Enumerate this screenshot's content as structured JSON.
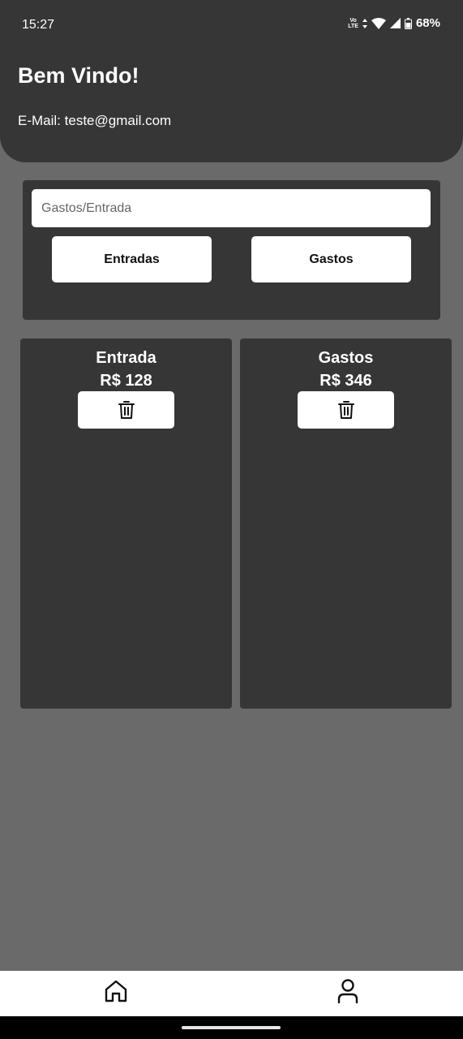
{
  "status_bar": {
    "time": "15:27",
    "network_label_top": "Vo",
    "network_label_bottom": "LTE",
    "battery": "68%",
    "icons": [
      "volte-icon",
      "data-arrows-icon",
      "wifi-icon",
      "signal-icon",
      "battery-icon"
    ]
  },
  "header": {
    "welcome": "Bem Vindo!",
    "email_label": "E-Mail:",
    "email_value": "teste@gmail.com"
  },
  "form": {
    "placeholder": "Gastos/Entrada",
    "value": "",
    "entradas_label": "Entradas",
    "gastos_label": "Gastos"
  },
  "cards": {
    "entrada": {
      "title": "Entrada",
      "value": "R$ 128"
    },
    "gastos": {
      "title": "Gastos",
      "value": "R$ 346"
    }
  },
  "nav": {
    "items": [
      "home-icon",
      "profile-icon"
    ]
  },
  "colors": {
    "background": "#6a6a6a",
    "panel": "#363636",
    "surface": "#ffffff",
    "text_on_panel": "#ffffff",
    "text_on_surface": "#111111"
  }
}
